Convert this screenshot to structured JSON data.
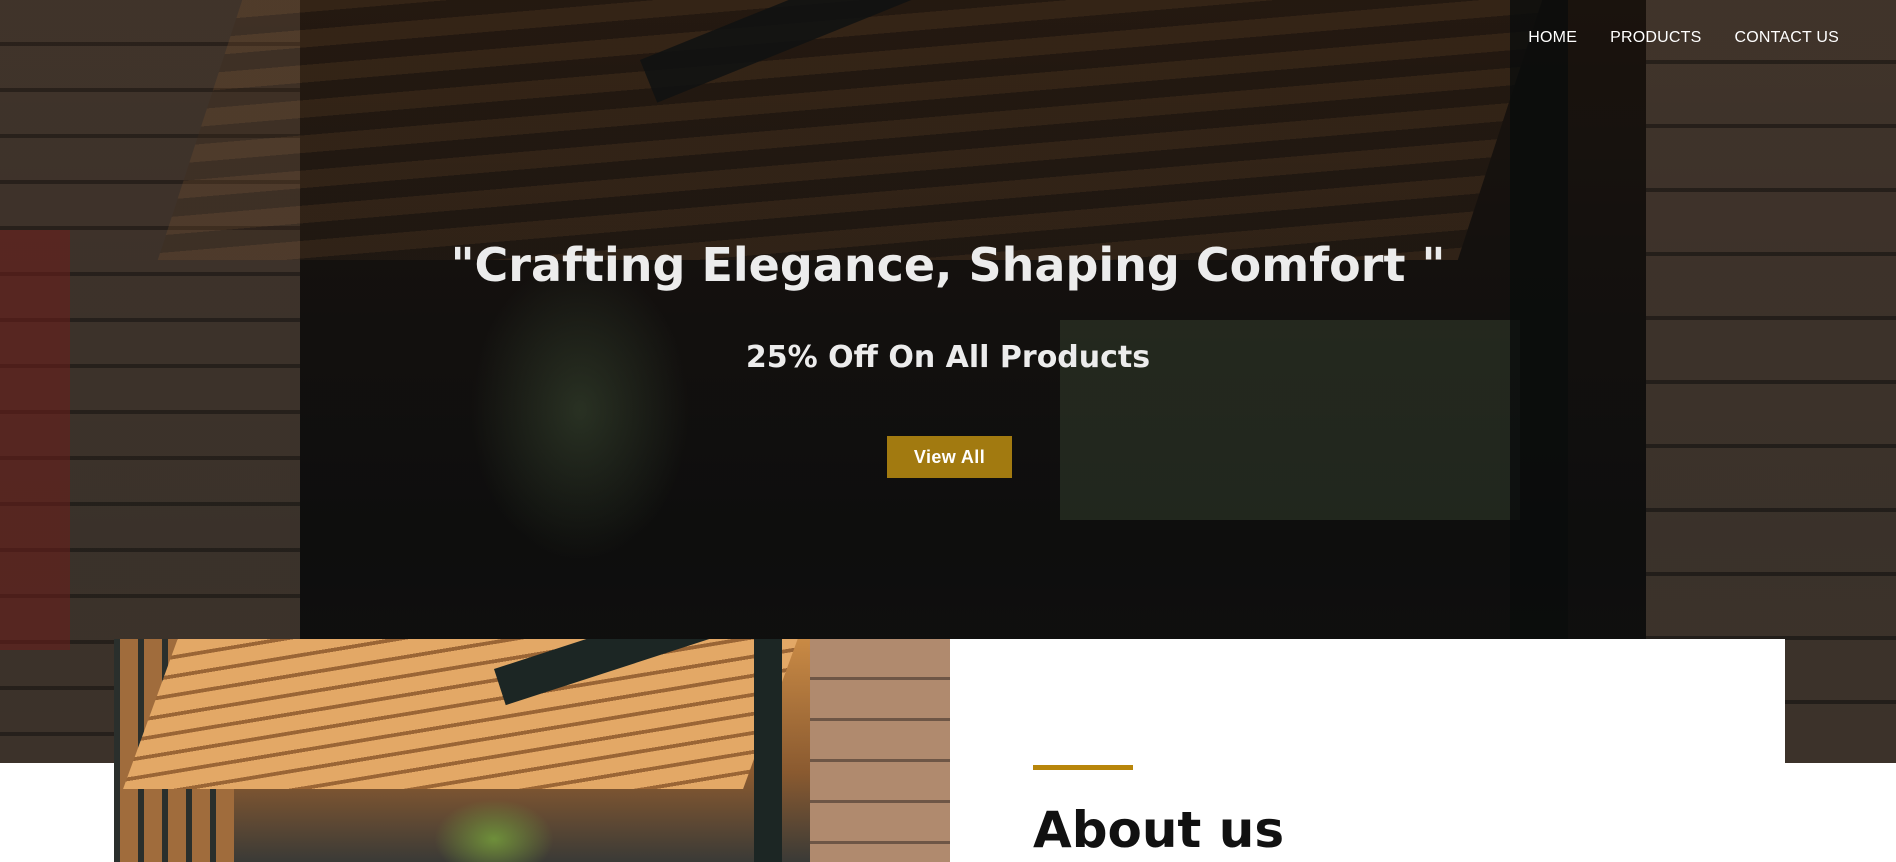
{
  "nav": {
    "items": [
      {
        "label": "HOME"
      },
      {
        "label": "PRODUCTS"
      },
      {
        "label": "CONTACT US"
      }
    ]
  },
  "hero": {
    "title": "\"Crafting Elegance, Shaping Comfort \"",
    "subtitle": "25% Off On All Products",
    "cta_label": "View All",
    "cta_color": "#a27a10"
  },
  "about": {
    "title": "About us",
    "accent_color": "#b8860b"
  }
}
